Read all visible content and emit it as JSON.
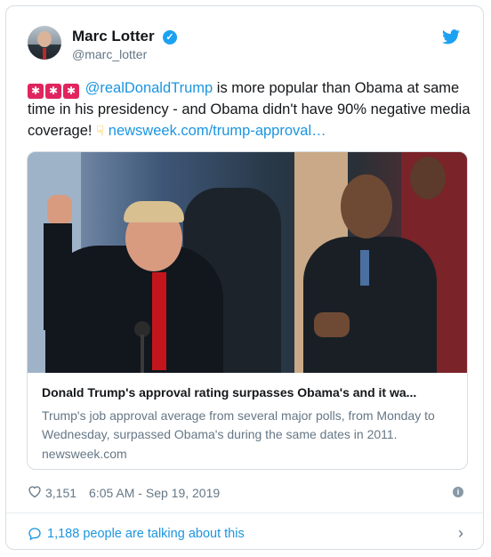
{
  "tweet": {
    "author_name": "Marc Lotter",
    "author_handle": "@marc_lotter",
    "mention": "@realDonaldTrump",
    "text_main": " is more popular than Obama at same time in his presidency - and Obama didn't have 90% negative media coverage! ",
    "link_text": "newsweek.com/trump-approval…",
    "likes": "3,151",
    "timestamp": "6:05 AM - Sep 19, 2019"
  },
  "link_card": {
    "title": "Donald Trump's approval rating surpasses Obama's and it wa...",
    "description": "Trump's job approval average from several major polls, from Monday to Wednesday, surpassed Obama's during the same dates in 2011.",
    "domain": "newsweek.com"
  },
  "footer": {
    "talking_text": "1,188 people are talking about this"
  },
  "icons": {
    "verified": "verified-badge-icon",
    "twitter": "twitter-bird-icon",
    "heart": "heart-icon",
    "info": "info-icon",
    "comment": "comment-icon",
    "chevron": "chevron-right-icon"
  },
  "colors": {
    "accent": "#1b95e0",
    "text": "#14171a",
    "muted": "#657786"
  }
}
